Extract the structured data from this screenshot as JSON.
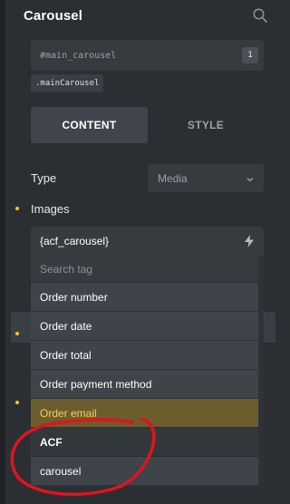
{
  "header": {
    "title": "Carousel",
    "search_icon": "search-icon"
  },
  "element": {
    "id": "#main_carousel",
    "id_count": "1",
    "class_chip": ".mainCarousel"
  },
  "tabs": {
    "content": "CONTENT",
    "style": "STYLE",
    "active": "content"
  },
  "controls": {
    "type_label": "Type",
    "type_value": "Media",
    "images_label": "Images",
    "images_value": "{acf_carousel}",
    "dynamic_icon": "bolt-icon"
  },
  "dropdown": {
    "search_placeholder": "Search tag",
    "items": [
      {
        "label": "Order number"
      },
      {
        "label": "Order date"
      },
      {
        "label": "Order total"
      },
      {
        "label": "Order payment method"
      },
      {
        "label": "Order email"
      }
    ],
    "highlighted": "Order email",
    "group": "ACF",
    "group_items": [
      {
        "label": "carousel"
      }
    ]
  },
  "colors": {
    "accent_yellow": "#f3c623",
    "annotation_red": "#e0141e",
    "panel_bg": "#2b2f33"
  }
}
